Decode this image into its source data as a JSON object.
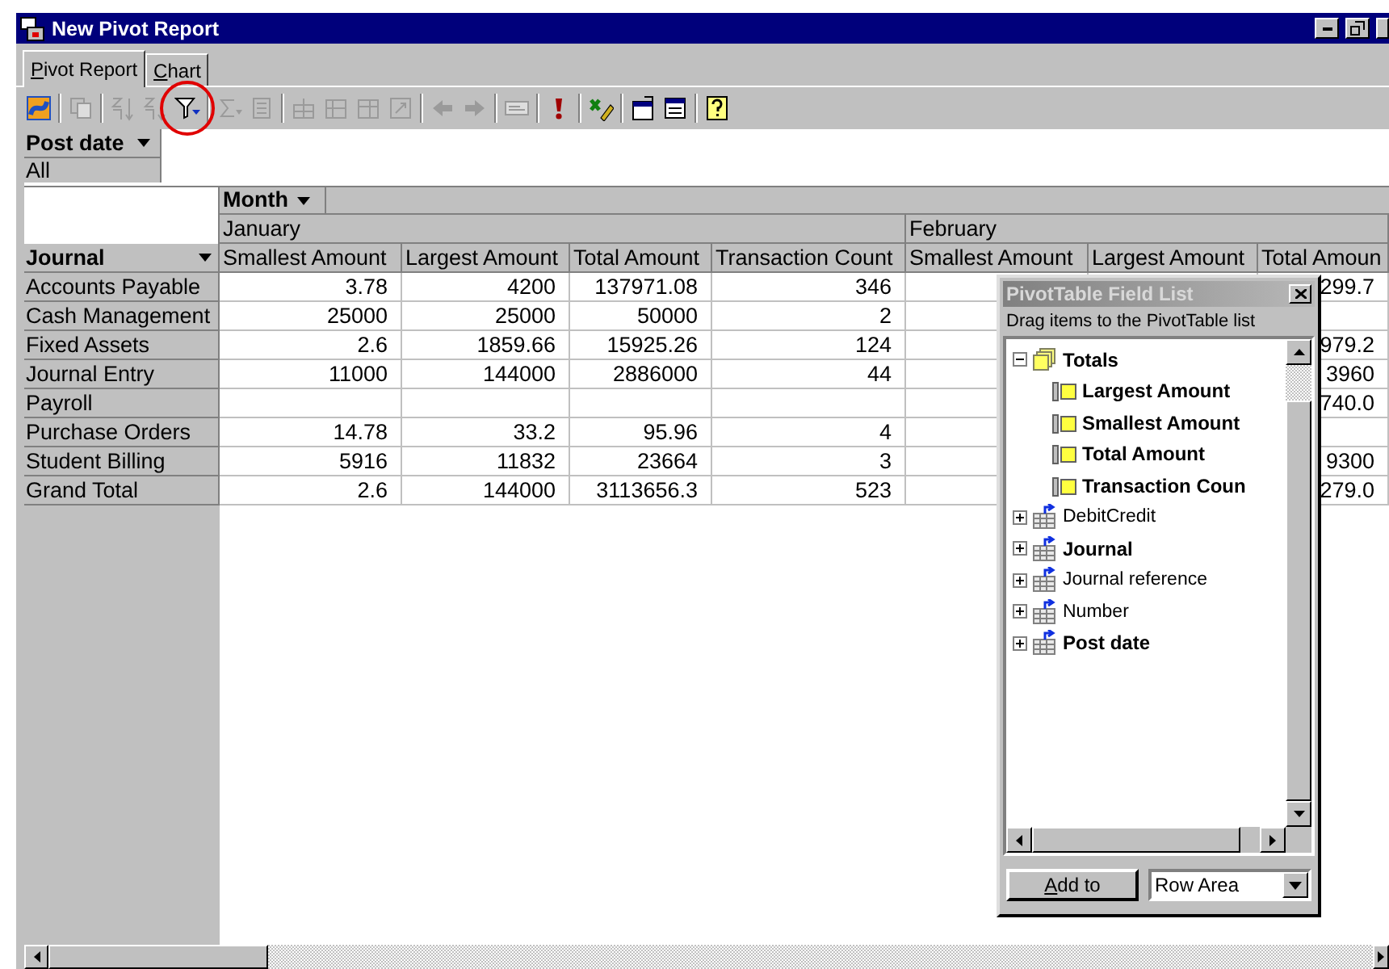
{
  "window": {
    "title": "New Pivot Report"
  },
  "tabs": [
    {
      "label": "Pivot Report",
      "selected": true
    },
    {
      "label": "Chart",
      "selected": false
    }
  ],
  "filter_area": {
    "field": "Post date",
    "value": "All"
  },
  "pivot": {
    "column_field": "Month",
    "row_field": "Journal",
    "months": [
      {
        "label": "January",
        "columns": [
          "Smallest Amount",
          "Largest Amount",
          "Total Amount",
          "Transaction Count"
        ]
      },
      {
        "label": "February",
        "columns": [
          "Smallest Amount",
          "Largest Amount",
          "Total Amoun"
        ]
      }
    ],
    "rows": [
      {
        "label": "Accounts Payable",
        "cells": [
          "3.78",
          "4200",
          "137971.08",
          "346",
          null,
          null,
          "299.7"
        ]
      },
      {
        "label": "Cash Management",
        "cells": [
          "25000",
          "25000",
          "50000",
          "2",
          null,
          null,
          null
        ]
      },
      {
        "label": "Fixed Assets",
        "cells": [
          "2.6",
          "1859.66",
          "15925.26",
          "124",
          null,
          null,
          "979.2"
        ]
      },
      {
        "label": "Journal Entry",
        "cells": [
          "11000",
          "144000",
          "2886000",
          "44",
          null,
          null,
          "3960"
        ]
      },
      {
        "label": "Payroll",
        "cells": [
          null,
          null,
          null,
          null,
          null,
          null,
          "740.0"
        ]
      },
      {
        "label": "Purchase Orders",
        "cells": [
          "14.78",
          "33.2",
          "95.96",
          "4",
          null,
          null,
          null
        ]
      },
      {
        "label": "Student Billing",
        "cells": [
          "5916",
          "11832",
          "23664",
          "3",
          null,
          null,
          "9300"
        ]
      },
      {
        "label": "Grand Total",
        "cells": [
          "2.6",
          "144000",
          "3113656.3",
          "523",
          null,
          null,
          "279.0"
        ]
      }
    ]
  },
  "field_list": {
    "title": "PivotTable Field List",
    "hint": "Drag items to the PivotTable list",
    "items": [
      {
        "label": "Totals",
        "kind": "totals",
        "used": true,
        "expanded": true,
        "children": [
          {
            "label": "Largest Amount",
            "kind": "measure",
            "used": true
          },
          {
            "label": "Smallest Amount",
            "kind": "measure",
            "used": true
          },
          {
            "label": "Total Amount",
            "kind": "measure",
            "used": true
          },
          {
            "label": "Transaction Coun",
            "kind": "measure",
            "used": true
          }
        ]
      },
      {
        "label": "DebitCredit",
        "kind": "field",
        "used": false,
        "expanded": false
      },
      {
        "label": "Journal",
        "kind": "field",
        "used": true,
        "expanded": false
      },
      {
        "label": "Journal reference",
        "kind": "field",
        "used": false,
        "expanded": false
      },
      {
        "label": "Number",
        "kind": "field",
        "used": false,
        "expanded": false
      },
      {
        "label": "Post date",
        "kind": "field",
        "used": true,
        "expanded": false
      }
    ],
    "add_button": "Add to",
    "area": "Row Area"
  }
}
